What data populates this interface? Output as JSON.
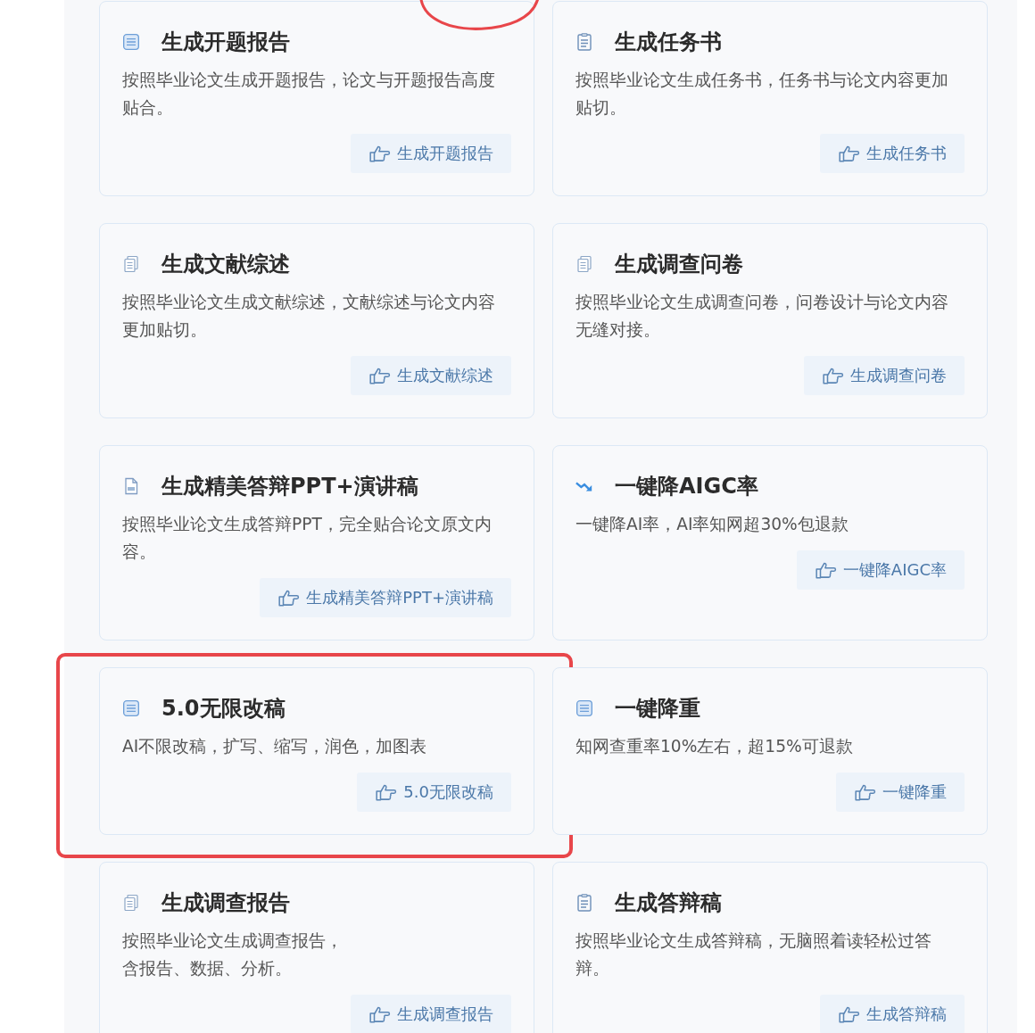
{
  "cards": [
    {
      "kind": "form",
      "title": "生成开题报告",
      "description": [
        "按照毕业论文生成开题报告，论文与开题报告高度贴合。"
      ],
      "button": "生成开题报告",
      "highlighted": false
    },
    {
      "kind": "list",
      "title": "生成任务书",
      "description": [
        "按照毕业论文生成任务书，任务书与论文内容更加贴切。"
      ],
      "button": "生成任务书",
      "highlighted": false
    },
    {
      "kind": "copy",
      "title": "生成文献综述",
      "description": [
        "按照毕业论文生成文献综述，文献综述与论文内容更加贴切。"
      ],
      "button": "生成文献综述",
      "highlighted": false
    },
    {
      "kind": "copy",
      "title": "生成调查问卷",
      "description": [
        "按照毕业论文生成调查问卷，问卷设计与论文内容无缝对接。"
      ],
      "button": "生成调查问卷",
      "highlighted": false
    },
    {
      "kind": "ppt",
      "title": "生成精美答辩PPT+演讲稿",
      "description": [
        "按照毕业论文生成答辩PPT，完全贴合论文原文内容。"
      ],
      "button": "生成精美答辩PPT+演讲稿",
      "highlighted": false
    },
    {
      "kind": "trend",
      "title": "一键降AIGC率",
      "description": [
        "一键降AI率，AI率知网超30%包退款"
      ],
      "button": "一键降AIGC率",
      "highlighted": false
    },
    {
      "kind": "form",
      "title": "5.0无限改稿",
      "description": [
        "AI不限改稿，扩写、缩写，润色，加图表"
      ],
      "button": "5.0无限改稿",
      "highlighted": true
    },
    {
      "kind": "form",
      "title": "一键降重",
      "description": [
        "知网查重率10%左右，超15%可退款"
      ],
      "button": "一键降重",
      "highlighted": false
    },
    {
      "kind": "copy",
      "title": "生成调查报告",
      "description": [
        "按照毕业论文生成调查报告，",
        "含报告、数据、分析。"
      ],
      "button": "生成调查报告",
      "highlighted": false
    },
    {
      "kind": "list",
      "title": "生成答辩稿",
      "description": [
        "按照毕业论文生成答辩稿，无脑照着读轻松过答辩。"
      ],
      "button": "生成答辩稿",
      "highlighted": false
    }
  ],
  "annotations": [
    {
      "kind": "ellipse"
    }
  ]
}
